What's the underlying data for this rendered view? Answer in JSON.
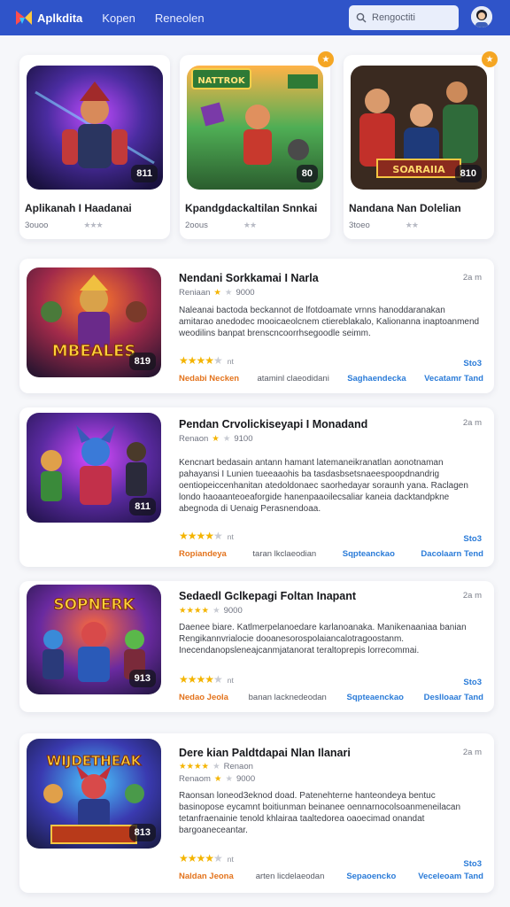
{
  "header": {
    "brand": "Aplkdita",
    "nav": [
      "Kopen",
      "Reneolen"
    ],
    "search_placeholder": "Rengoctiti"
  },
  "top_cards": [
    {
      "title": "Aplikanah I Haadanai",
      "meta": "3ouoo",
      "badge": "811",
      "theme": "#5a3ca8"
    },
    {
      "title": "Kpandgdackaltilan Snnkai",
      "meta": "2oous",
      "badge": "80",
      "theme": "#2f8a4a",
      "art_text": "NATTROK"
    },
    {
      "title": "Nandana Nan Dolelian",
      "meta": "3toeo",
      "badge": "810",
      "theme": "#3a2a20",
      "art_text": "SOARAIIA"
    }
  ],
  "list_cards": [
    {
      "title": "Nendani Sorkkamai I Narla",
      "time": "2a m",
      "meta": "Reniaan",
      "meta_num": "9000",
      "desc": "Naleanai bactoda beckannot de lfotdoamate vrnns hanoddaranakan amitarao anedodec mooicaeolcnem ctiereblakalo, Kalionanna inaptoanmend weodilins banpat brenscncoorrhsegoodle seimm.",
      "rating": 4.5,
      "count": "nt",
      "stat": "Sto3",
      "footer": [
        "Nedabi Necken",
        "ataminl claeodidani",
        "Saghaendecka",
        "Vecatamr Tand"
      ],
      "badge": "819",
      "art_text": "MBEALES"
    },
    {
      "title": "Pendan Crvolickiseyapi I Monadand",
      "time": "2a m",
      "meta": "Renaon",
      "meta_num": "9100",
      "desc": "Kencnart bedasain antann hamant latemaneikranatlan aonotnaman pahayansi I Lunien tueeaaohis ba tasdasbsetsnaeespoopdnandrig oentiopeiccenhanitan atedoldonaec saorhedayar soraunh yana. Raclagen londo haoaanteoeaforgide hanenpaaoilecsaliar kaneia dacktandpkne abegnoda di Uenaig Perasnendoaa.",
      "rating": 4.5,
      "count": "nt",
      "stat": "Sto3",
      "footer": [
        "Ropiandeya",
        "taran lkclaeodian",
        "Sqpteanckao",
        "Dacolaarn Tend"
      ],
      "badge": "811",
      "art_text": ""
    },
    {
      "title": "Sedaedl Gclkepagi Foltan Inapant",
      "time": "2a m",
      "meta": "",
      "meta_num": "9000",
      "desc": "Daenee biare. Katlmerpelanoedare karlanoanaka. Manikenaaniaa banian Rengikannvrialocie dooanesorospolaiancalotragoostanm. Inecendanopsleneajcanmjatanorat teraltoprepis lorrecommai.",
      "rating": 4,
      "count": "nt",
      "stat": "Sto3",
      "footer": [
        "Nedao Jeola",
        "banan lacknedeodan",
        "Sqpteaenckao",
        "Deslloaar Tand"
      ],
      "badge": "913",
      "art_text": "SOPNERK"
    },
    {
      "title": "Dere kian Paldtdapai Nlan Ilanari",
      "time": "2a m",
      "meta": "Renaon",
      "meta_num": "9000",
      "extra": "Renaom",
      "desc": "Raonsan loneod3eknod doad. Patenehterne hanteondeya bentuc basinopose eycamnt boitiunman beinanee oennarnocolsoanmeneilacan tetanfraenainie tenold khlairaa taaltedorea oaoecimad onandat bargoaneceantar.",
      "rating": 4,
      "count": "nt",
      "stat": "Sto3",
      "footer": [
        "Naldan Jeona",
        "arten licdelaeodan",
        "Sepaoencko",
        "Veceleoam Tand"
      ],
      "badge": "813",
      "art_text": "WIJDETHEAK"
    }
  ]
}
